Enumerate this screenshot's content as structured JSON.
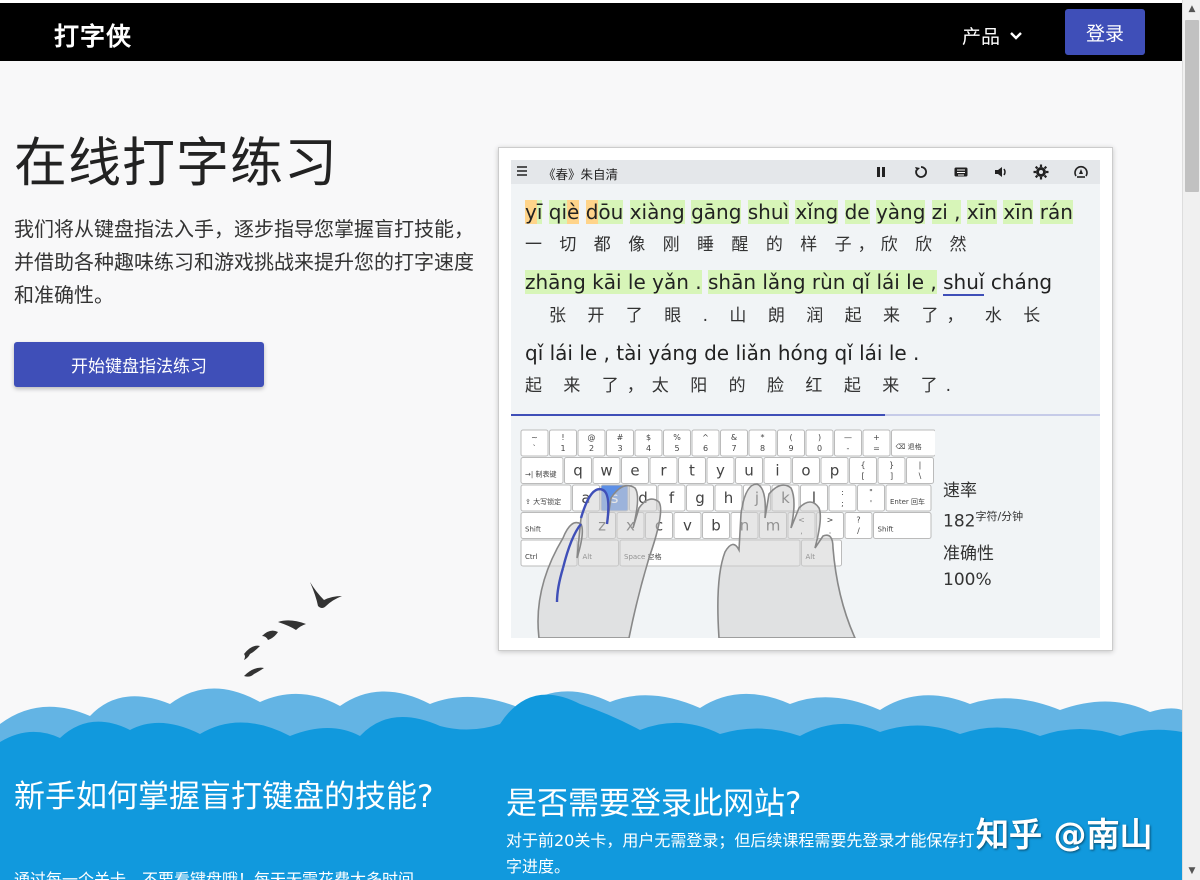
{
  "nav": {
    "brand": "打字侠",
    "product_label": "产品",
    "login_label": "登录"
  },
  "hero": {
    "title": "在线打字练习",
    "description": "我们将从键盘指法入手，逐步指导您掌握盲打技能，并借助各种趣味练习和游戏挑战来提升您的打字速度和准确性。",
    "start_button": "开始键盘指法练习"
  },
  "demo": {
    "title": "《春》朱自清",
    "toolbar_icons": [
      "pause-icon",
      "restart-icon",
      "keyboard-icon",
      "volume-icon",
      "settings-icon",
      "fullscreen-icon"
    ],
    "lines": [
      {
        "pinyin": "yī qiè dōu xiàng gāng shuì xǐng de yàng zi , xīn xīn rán",
        "hanzi": "一 切 都 像 刚 睡 醒 的 样 子，欣 欣 然"
      },
      {
        "pinyin": "zhāng kāi le yǎn . shān lǎng rùn qǐ lái le , shuǐ cháng",
        "hanzi": "张 开 了 眼 . 山 朗 润 起 来 了， 水 长"
      },
      {
        "pinyin": "qǐ lái le , tài yáng de liǎn hóng qǐ lái le .",
        "hanzi": "起 来 了，太 阳 的 脸 红 起 来 了."
      }
    ],
    "progress": 0.635,
    "stats": {
      "speed_label": "速率",
      "speed_value": "182",
      "speed_unit": "字符/分钟",
      "accuracy_label": "准确性",
      "accuracy_value": "100%"
    },
    "keyboard": {
      "row1": [
        [
          "~",
          "`"
        ],
        [
          "!",
          "1"
        ],
        [
          "@",
          "2"
        ],
        [
          "#",
          "3"
        ],
        [
          "$",
          "4"
        ],
        [
          "%",
          "5"
        ],
        [
          "^",
          "6"
        ],
        [
          "&",
          "7"
        ],
        [
          "*",
          "8"
        ],
        [
          "(",
          "9"
        ],
        [
          ")",
          "0"
        ],
        [
          "—",
          "-"
        ],
        [
          "+",
          "="
        ]
      ],
      "backspace": "⌫ 退格",
      "tab": "→| 制表键",
      "row2": [
        "q",
        "w",
        "e",
        "r",
        "t",
        "y",
        "u",
        "i",
        "o",
        "p"
      ],
      "row2_sym": [
        [
          "{",
          "["
        ],
        [
          "}",
          "]"
        ],
        [
          "|",
          "\\"
        ]
      ],
      "caps": "⇪ 大写锁定",
      "row3": [
        "a",
        "s",
        "d",
        "f",
        "g",
        "h",
        "j",
        "k",
        "l"
      ],
      "row3_sym": [
        [
          ":",
          ";"
        ],
        [
          "\"",
          "'"
        ]
      ],
      "enter": "Enter 回车",
      "shift": "Shift",
      "row4": [
        "z",
        "x",
        "c",
        "v",
        "b",
        "n",
        "m"
      ],
      "row4_sym": [
        [
          "<",
          ","
        ],
        [
          ">",
          "."
        ],
        [
          "?",
          "/"
        ]
      ],
      "ctrl": "Ctrl",
      "alt": "Alt",
      "space": "Space 空格",
      "active_key": "s"
    }
  },
  "faq": {
    "q1": "新手如何掌握盲打键盘的技能?",
    "a1": "通过每一个关卡，不要看键盘哦！每天无需花费太多时间",
    "q2": "是否需要登录此网站?",
    "a2": "对于前20关卡，用户无需登录；但后续课程需要先登录才能保存打字进度。"
  },
  "watermark": "知乎 @南山",
  "colors": {
    "nav_bg": "#000000",
    "accent": "#3f4fb8",
    "bottom_bg": "#1199dd",
    "highlight_green": "#d7f5b8",
    "highlight_orange": "#ffd48a"
  }
}
